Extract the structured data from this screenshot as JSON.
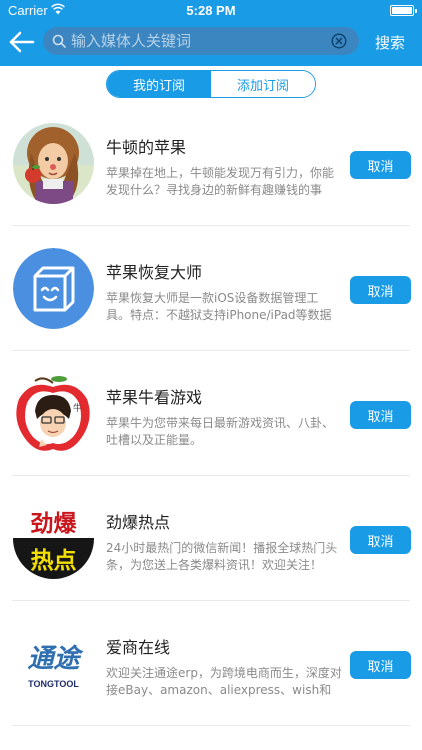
{
  "status_bar": {
    "carrier": "Carrier",
    "time": "5:28 PM"
  },
  "search": {
    "placeholder": "输入媒体人关键词",
    "button_label": "搜索"
  },
  "tabs": [
    {
      "label": "我的订阅",
      "active": true
    },
    {
      "label": "添加订阅",
      "active": false
    }
  ],
  "subscriptions": [
    {
      "title": "牛顿的苹果",
      "description": "苹果掉在地上，牛顿能发现万有引力，你能发现什么？寻找身边的新鲜有趣赚钱的事",
      "button": "取消"
    },
    {
      "title": "苹果恢复大师",
      "description": "苹果恢复大师是一款iOS设备数据管理工具。特点：不越狱支持iPhone/iPad等数据",
      "button": "取消"
    },
    {
      "title": "苹果牛看游戏",
      "description": "苹果牛为您带来每日最新游戏资讯、八卦、吐槽以及正能量。",
      "button": "取消"
    },
    {
      "title": "劲爆热点",
      "description": "24小时最热门的微信新闻！播报全球热门头条，为您送上各类爆料资讯！欢迎关注！",
      "button": "取消"
    },
    {
      "title": "爱商在线",
      "description": "欢迎关注通途erp，为跨境电商而生，深度对接eBay、amazon、aliexpress、wish和",
      "button": "取消"
    }
  ],
  "logos": {
    "jinbao_top": "劲爆",
    "jinbao_bottom": "热点",
    "tongtu_cn": "通途",
    "tongtu_en": "TONGTOOL",
    "apple_badge": "牛"
  },
  "colors": {
    "accent": "#1a9be6",
    "search_field": "#3b86c1"
  }
}
